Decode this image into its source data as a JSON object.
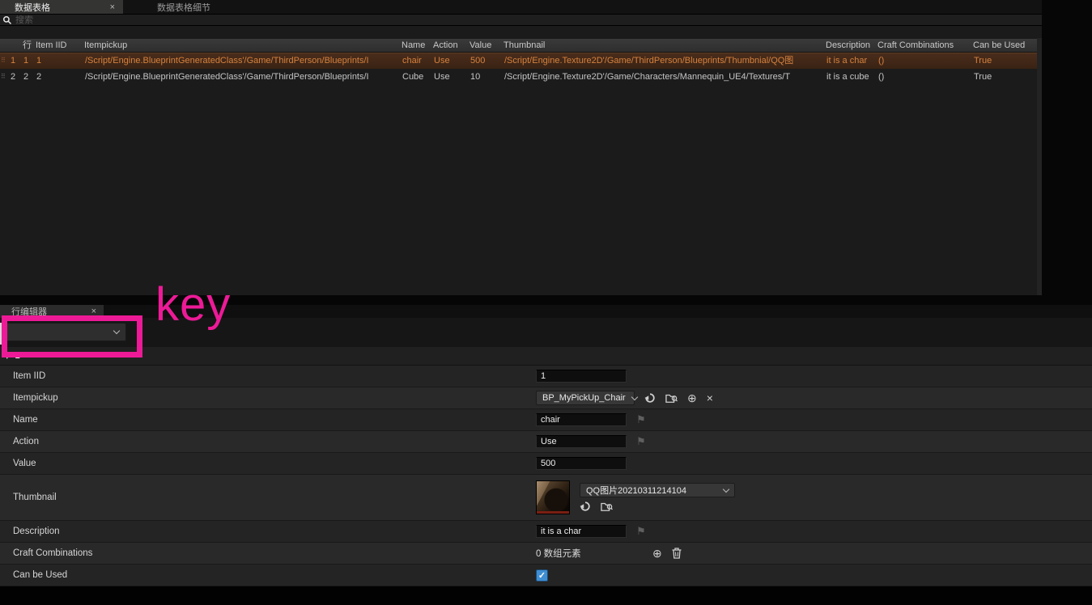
{
  "glyphs": {
    "close": "×",
    "drag": "⠿",
    "expander": "▾",
    "flag": "⚑",
    "plus": "⊕",
    "clear": "×",
    "check": "✓"
  },
  "window": {
    "tabs": [
      {
        "label": "数据表格"
      },
      {
        "label": "数据表格细节"
      }
    ]
  },
  "search": {
    "placeholder": "搜索"
  },
  "table": {
    "headers": {
      "row": "行",
      "item_iid": "Item IID",
      "itempickup": "Itempickup",
      "name": "Name",
      "action": "Action",
      "value": "Value",
      "thumbnail": "Thumbnail",
      "description": "Description",
      "craft": "Craft Combinations",
      "can_be_used": "Can be Used"
    },
    "rows": [
      {
        "index": "1",
        "row_name": "1",
        "item_iid": "1",
        "itempickup": "/Script/Engine.BlueprintGeneratedClass'/Game/ThirdPerson/Blueprints/I",
        "name": "chair",
        "action": "Use",
        "value": "500",
        "thumbnail": "/Script/Engine.Texture2D'/Game/ThirdPerson/Blueprints/Thumbnial/QQ图",
        "description": "it is a char",
        "craft": "()",
        "can_be_used": "True"
      },
      {
        "index": "2",
        "row_name": "2",
        "item_iid": "2",
        "itempickup": "/Script/Engine.BlueprintGeneratedClass'/Game/ThirdPerson/Blueprints/I",
        "name": "Cube",
        "action": "Use",
        "value": "10",
        "thumbnail": "/Script/Engine.Texture2D'/Game/Characters/Mannequin_UE4/Textures/T",
        "description": "it is a cube",
        "craft": "()",
        "can_be_used": "True"
      }
    ]
  },
  "row_editor": {
    "tab": {
      "label": "行编辑器"
    },
    "row_selector_value": "",
    "row_header": "1",
    "properties": {
      "item_iid": {
        "label": "Item IID",
        "value": "1"
      },
      "itempickup": {
        "label": "Itempickup",
        "value": "BP_MyPickUp_Chair"
      },
      "name": {
        "label": "Name",
        "value": "chair"
      },
      "action": {
        "label": "Action",
        "value": "Use"
      },
      "value": {
        "label": "Value",
        "value": "500"
      },
      "thumbnail": {
        "label": "Thumbnail",
        "value": "QQ图片20210311214104"
      },
      "description": {
        "label": "Description",
        "value": "it is a char"
      },
      "craft": {
        "label": "Craft Combinations",
        "value": "0 数组元素"
      },
      "can_be_used": {
        "label": "Can be Used",
        "checked": true
      }
    }
  },
  "annotation": {
    "text": "key"
  },
  "colors": {
    "annotation": "#ed1a97",
    "selected_row_text": "#d6823e",
    "checkbox_fill": "#3f8ed2"
  }
}
